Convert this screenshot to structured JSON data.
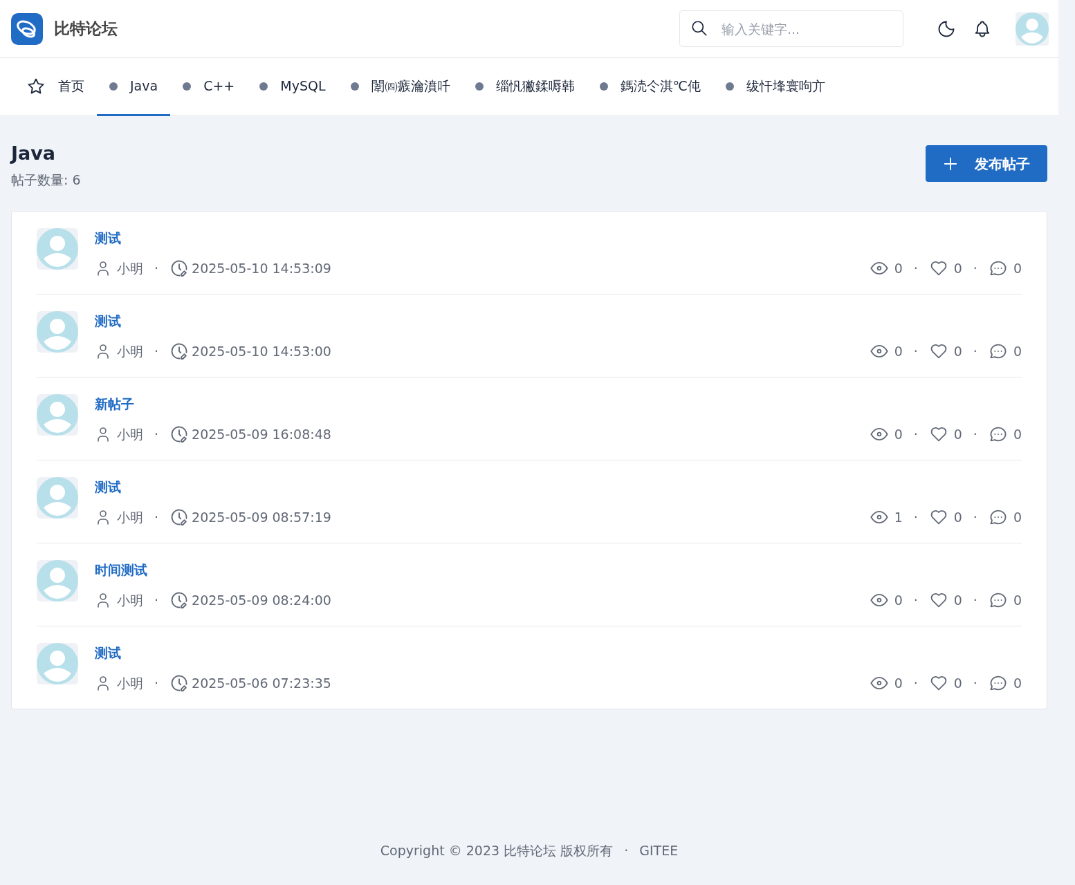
{
  "brand": {
    "name": "比特论坛"
  },
  "search": {
    "placeholder": "输入关键字..."
  },
  "nav": [
    {
      "label": "首页",
      "kind": "home",
      "selected": false
    },
    {
      "label": "Java",
      "kind": "board",
      "selected": true
    },
    {
      "label": "C++",
      "kind": "board",
      "selected": false
    },
    {
      "label": "MySQL",
      "kind": "board",
      "selected": false
    },
    {
      "label": "闈㈣瘯瀹濆吀",
      "kind": "board",
      "selected": false
    },
    {
      "label": "缁忛獙鍒嗕韩",
      "kind": "board",
      "selected": false
    },
    {
      "label": "鎷涜仒淇℃伅",
      "kind": "board",
      "selected": false
    },
    {
      "label": "绂忓埄寰呴亣",
      "kind": "board",
      "selected": false
    }
  ],
  "board": {
    "title": "Java",
    "count": "帖子数量: 6"
  },
  "new_post_button": "发布帖子",
  "posts": [
    {
      "title": "测试",
      "author": "小明",
      "time": "2025-05-10 14:53:09",
      "views": "0",
      "likes": "0",
      "comments": "0",
      "separators": [
        "·",
        "·",
        "·"
      ]
    },
    {
      "title": "测试",
      "author": "小明",
      "time": "2025-05-10 14:53:00",
      "views": "0",
      "likes": "0",
      "comments": "0",
      "separators": [
        "·",
        "·",
        "·"
      ]
    },
    {
      "title": "新帖子",
      "author": "小明",
      "time": "2025-05-09 16:08:48",
      "views": "0",
      "likes": "0",
      "comments": "0",
      "separators": [
        "·",
        "·",
        "·"
      ]
    },
    {
      "title": "测试",
      "author": "小明",
      "time": "2025-05-09 08:57:19",
      "views": "1",
      "likes": "0",
      "comments": "0",
      "separators": [
        "·",
        "·",
        "·"
      ]
    },
    {
      "title": "时间测试",
      "author": "小明",
      "time": "2025-05-09 08:24:00",
      "views": "0",
      "likes": "0",
      "comments": "0",
      "separators": [
        "·",
        "·",
        "·"
      ]
    },
    {
      "title": "测试",
      "author": "小明",
      "time": "2025-05-06 07:23:35",
      "views": "0",
      "likes": "0",
      "comments": "0",
      "separators": [
        "·",
        "·",
        "·"
      ]
    }
  ],
  "footer": {
    "copyright": "Copyright © 2023 比特论坛 版权所有",
    "separator": "·",
    "link": "GITEE"
  }
}
